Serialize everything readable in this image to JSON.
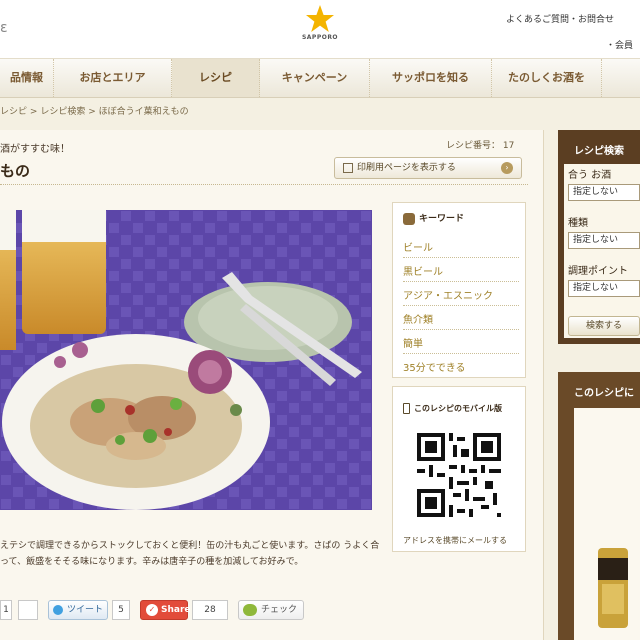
{
  "header": {
    "edge_char": "ε",
    "logo_text": "SAPPORO",
    "faq_link": "よくあるご質問・お問合せ",
    "members_link": "・会員"
  },
  "nav": {
    "items": [
      {
        "label": "品情報"
      },
      {
        "label": "お店とエリア"
      },
      {
        "label": "レシピ"
      },
      {
        "label": "キャンペーン"
      },
      {
        "label": "サッポロを知る"
      },
      {
        "label": "たのしくお酒を"
      }
    ],
    "active_index": 2
  },
  "breadcrumb": {
    "items": [
      "レシピ",
      "レシピ検索",
      "ほぼ合うイ菓和えもの"
    ],
    "separator": ">"
  },
  "recipe": {
    "subtitle": "酒がすすむ味！",
    "title": "もの",
    "id_label": "レシピ番号： 17",
    "print_button": "印刷用ページを表示する",
    "description": "えテシで調理できるからストックしておくと便利！缶の汁も丸ごと使います。さばの うよく合って、飯盛をそそる味になります。辛みは唐辛子の種を加減してお好みで。"
  },
  "keywords": {
    "heading": "キーワード",
    "items": [
      "ビール",
      "黒ビール",
      "アジア・エスニック",
      "魚介類",
      "簡単",
      "35分でできる"
    ]
  },
  "mobile": {
    "heading": "このレシピのモバイル版",
    "link": "アドレスを携帯にメールする"
  },
  "social": {
    "like_count": "1",
    "tweet_label": "ツイート",
    "tweet_count": "5",
    "share_label": "Share",
    "share_count": "28",
    "check_label": "チェック"
  },
  "sidebar": {
    "title": "レシピ検索",
    "fields": [
      {
        "label": "合う お酒",
        "value": "指定しない"
      },
      {
        "label": "種類",
        "value": "指定しない"
      },
      {
        "label": "調理ポイント",
        "value": "指定しない"
      }
    ],
    "search_button": "検索する",
    "promo_title": "このレシピに"
  },
  "colors": {
    "accent_brown": "#5b3e22",
    "keyword_gold": "#a0822a",
    "logo_star": "#f4b400",
    "share_red": "#e24b3a"
  }
}
